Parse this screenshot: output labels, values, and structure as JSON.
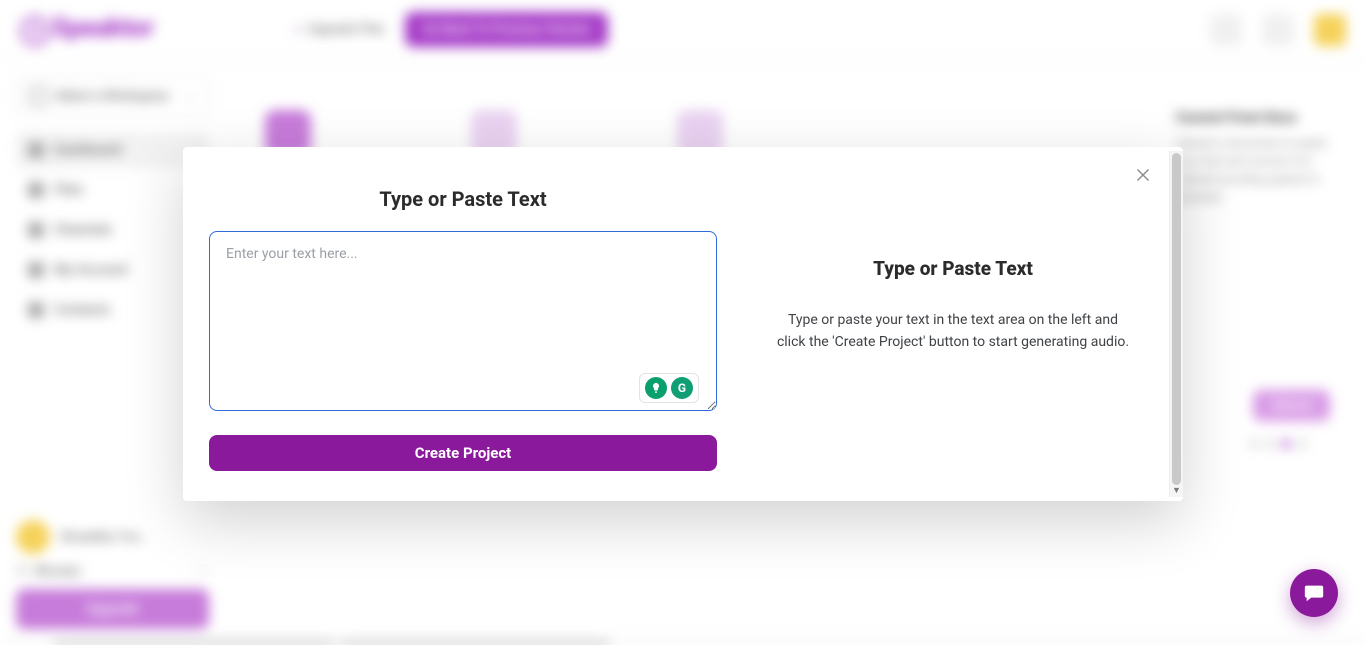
{
  "app": {
    "brand": "Speaktor",
    "plan_label": "Upgrade Plan",
    "go_back_label": "Go Back To Previous Version"
  },
  "sidebar": {
    "workspace_label": "Select a Workspace",
    "items": [
      {
        "label": "Dashboard"
      },
      {
        "label": "Files"
      },
      {
        "label": "Channels"
      },
      {
        "label": "My Account"
      },
      {
        "label": "Contacts"
      }
    ],
    "user_name": "Shraddha Tiw…",
    "minutes_label": "Minutes",
    "upgrade_label": "Upgrade"
  },
  "background": {
    "right_card_title": "Convert From Docs",
    "right_card_desc": "Upload a document or paste your text and convert it to natural-sounding speech in seconds.",
    "chip_label": "Upload"
  },
  "modal": {
    "left_title": "Type or Paste Text",
    "textarea_placeholder": "Enter your text here...",
    "create_label": "Create Project",
    "right_title": "Type or Paste Text",
    "right_desc": "Type or paste your text in the text area on the left and click the 'Create Project' button to start generating audio."
  }
}
